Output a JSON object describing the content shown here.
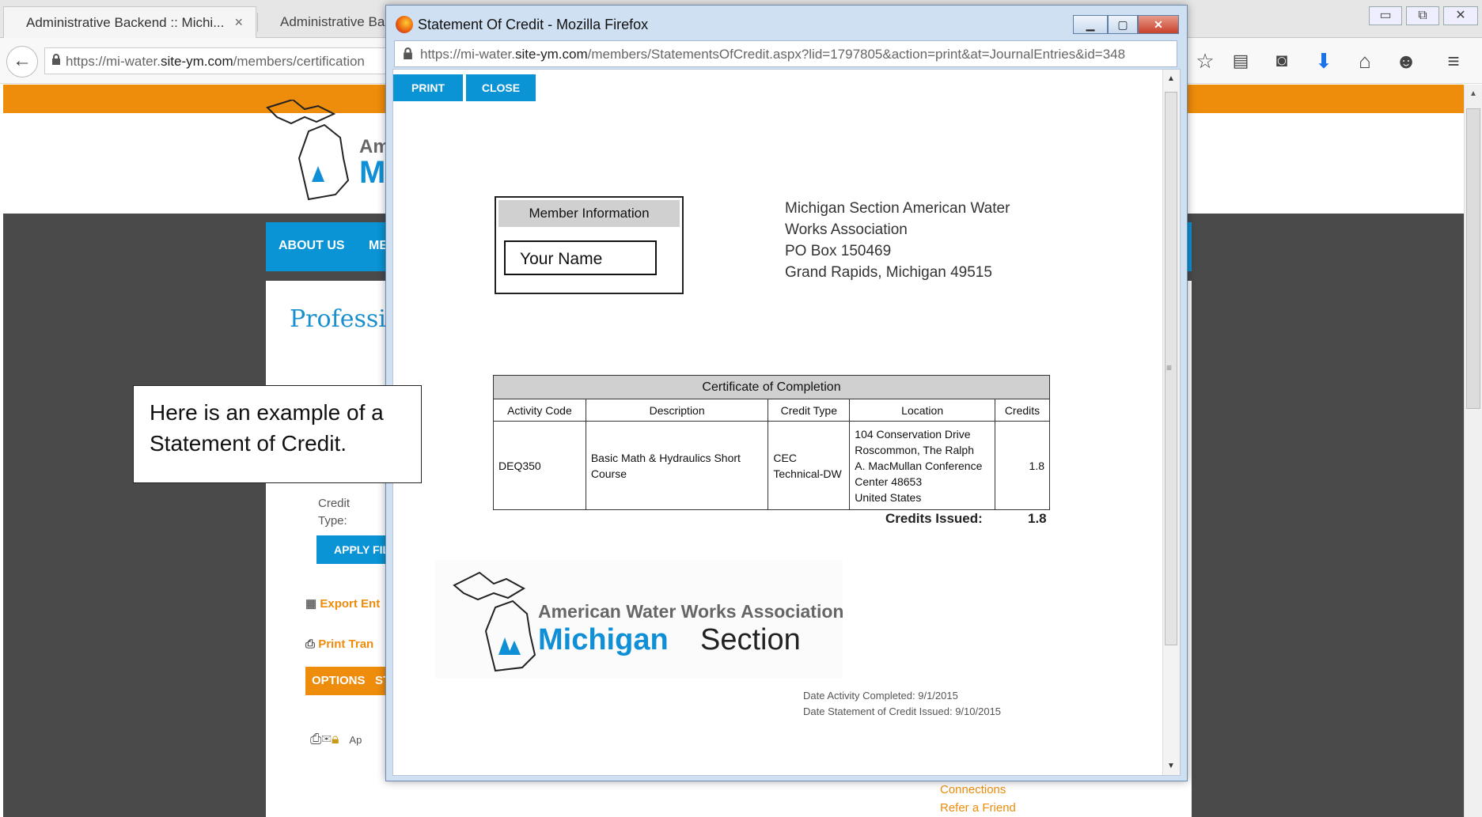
{
  "browser": {
    "tabs": [
      {
        "label": "Administrative Backend :: Michi...",
        "close": "×"
      },
      {
        "label": "Administrative Backe"
      }
    ],
    "url_prefix": "https://mi-water.",
    "url_domain": "site-ym.com",
    "url_path": "/members/certification",
    "toolbar_icons": [
      "star-icon",
      "reading-list-icon",
      "pocket-icon",
      "download-icon",
      "home-icon",
      "smiley-icon",
      "menu-icon"
    ]
  },
  "site": {
    "menu": {
      "about": "ABOUT US",
      "members_partial": "ME"
    },
    "logo_partial_top": "Am",
    "logo_partial_bottom": "M",
    "page_title_partial": "Professi",
    "credit_type_label": "Credit Type:",
    "apply_label": "APPLY FIL",
    "export_label": "Export Ent",
    "print_label": "Print Tran",
    "options_label": "OPTIONS",
    "options_partial": "ST",
    "row_text_partial": "Ap",
    "footer_links": {
      "connections": "Connections",
      "refer": "Refer a Friend"
    }
  },
  "popup": {
    "title": "Statement Of Credit - Mozilla Firefox",
    "url_prefix": "https://mi-water.",
    "url_domain": "site-ym.com",
    "url_path": "/members/StatementsOfCredit.aspx?lid=1797805&action=print&at=JournalEntries&id=348",
    "print_label": "PRINT",
    "close_label": "CLOSE",
    "member_info_header": "Member Information",
    "member_name": "Your Name",
    "org_address": {
      "line1": "Michigan Section American Water",
      "line2": "Works Association",
      "line3": "PO Box 150469",
      "line4": "Grand Rapids, Michigan  49515"
    },
    "certificate": {
      "caption": "Certificate of Completion",
      "headers": [
        "Activity Code",
        "Description",
        "Credit Type",
        "Location",
        "Credits"
      ],
      "row": {
        "activity_code": "DEQ350",
        "description": "Basic Math & Hydraulics Short Course",
        "credit_type_1": "CEC",
        "credit_type_2": "Technical-DW",
        "location_1": "104 Conservation Drive",
        "location_2": "Roscommon, The Ralph",
        "location_3": "A. MacMullan Conference",
        "location_4": "Center  48653",
        "location_5": "United States",
        "credits": "1.8"
      }
    },
    "credits_issued_label": "Credits Issued:",
    "credits_issued_value": "1.8",
    "logo_line1": "American Water Works Association",
    "logo_michigan": "Michigan",
    "logo_section": "Section",
    "date_completed": "Date Activity Completed: 9/1/2015",
    "date_issued": "Date Statement of Credit Issued: 9/10/2015"
  },
  "callout": {
    "line1": "Here is an example of a",
    "line2": "Statement of Credit."
  },
  "colors": {
    "accent_orange": "#ee8c0b",
    "accent_blue": "#0a93d5",
    "dark_bg": "#4a4a4a"
  }
}
